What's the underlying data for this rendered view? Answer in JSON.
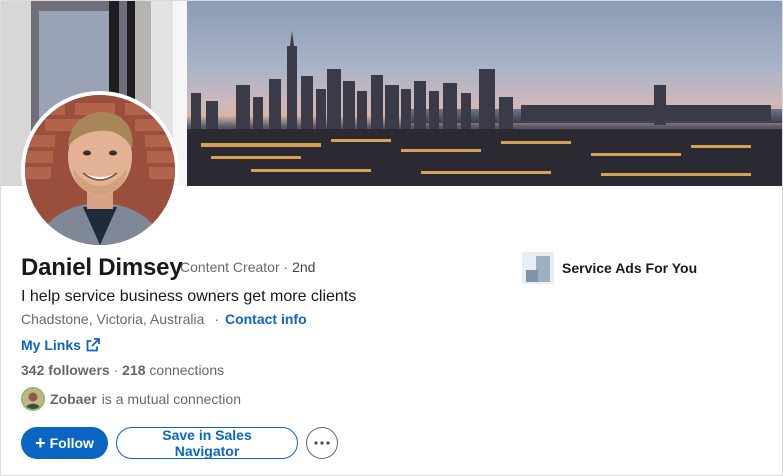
{
  "profile": {
    "name": "Daniel Dimsey",
    "title": "Content Creator",
    "degree": "2nd",
    "headline": "I help service business owners get more clients",
    "location": "Chadstone, Victoria, Australia",
    "contact_label": "Contact info",
    "links_label": "My Links",
    "followers_count": "342 followers",
    "connections_count": "218",
    "connections_label": "connections",
    "mutual_name": "Zobaer",
    "mutual_text": "is a mutual connection"
  },
  "actions": {
    "follow_label": "Follow",
    "sales_navigator_label": "Save in Sales Navigator",
    "more_icon": "more-icon"
  },
  "ad": {
    "label": "Service Ads For You"
  },
  "colors": {
    "accent": "#0a66c2",
    "mutual_ring": "#7fc15e"
  }
}
